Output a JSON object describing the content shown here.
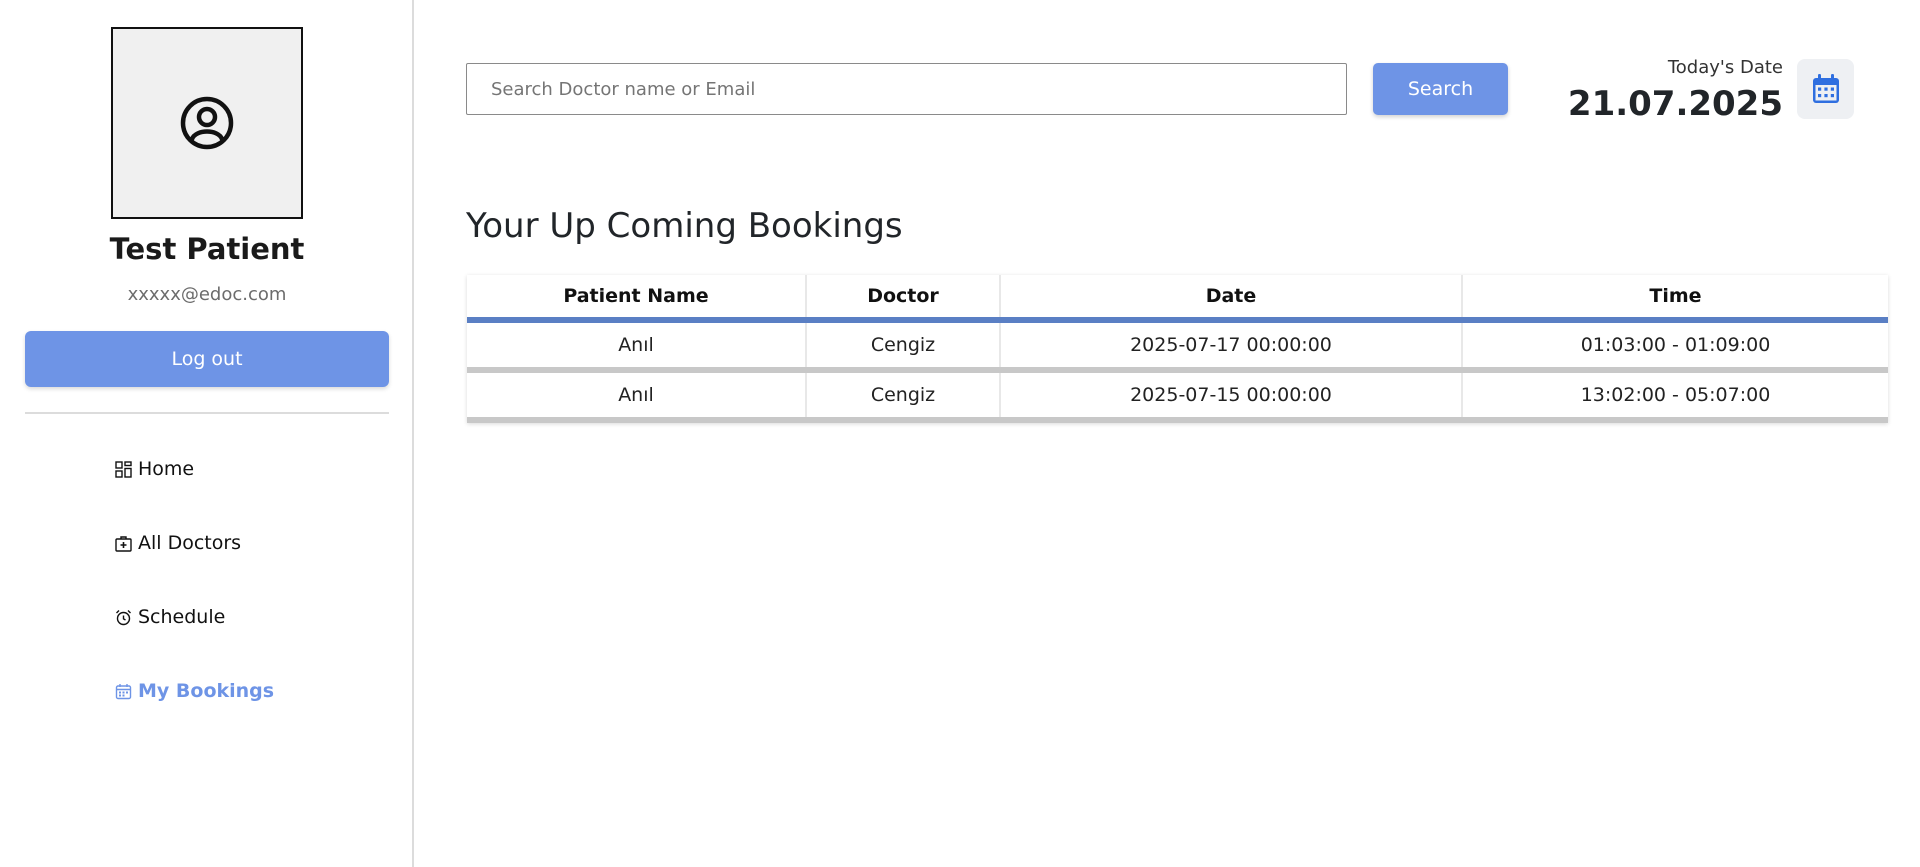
{
  "profile": {
    "name": "Test Patient",
    "email": "xxxxx@edoc.com",
    "logout_label": "Log out"
  },
  "nav": {
    "items": [
      {
        "label": "Home",
        "icon": "grid-icon",
        "active": false
      },
      {
        "label": "All Doctors",
        "icon": "medical-bag-icon",
        "active": false
      },
      {
        "label": "Schedule",
        "icon": "alarm-clock-icon",
        "active": false
      },
      {
        "label": "My Bookings",
        "icon": "calendar-icon",
        "active": true
      }
    ]
  },
  "search": {
    "placeholder": "Search Doctor name or Email",
    "value": "",
    "button_label": "Search"
  },
  "today": {
    "label": "Today's Date",
    "value": "21.07.2025"
  },
  "bookings": {
    "title": "Your Up Coming Bookings",
    "columns": [
      "Patient Name",
      "Doctor",
      "Date",
      "Time"
    ],
    "rows": [
      [
        "Anıl",
        "Cengiz",
        "2025-07-17 00:00:00",
        "01:03:00 - 01:09:00"
      ],
      [
        "Anıl",
        "Cengiz",
        "2025-07-15 00:00:00",
        "13:02:00 - 05:07:00"
      ]
    ]
  },
  "colors": {
    "accent": "#6e94e6",
    "table_header_rule": "#5a7fc4",
    "calendar_icon": "#2f6fe0"
  }
}
